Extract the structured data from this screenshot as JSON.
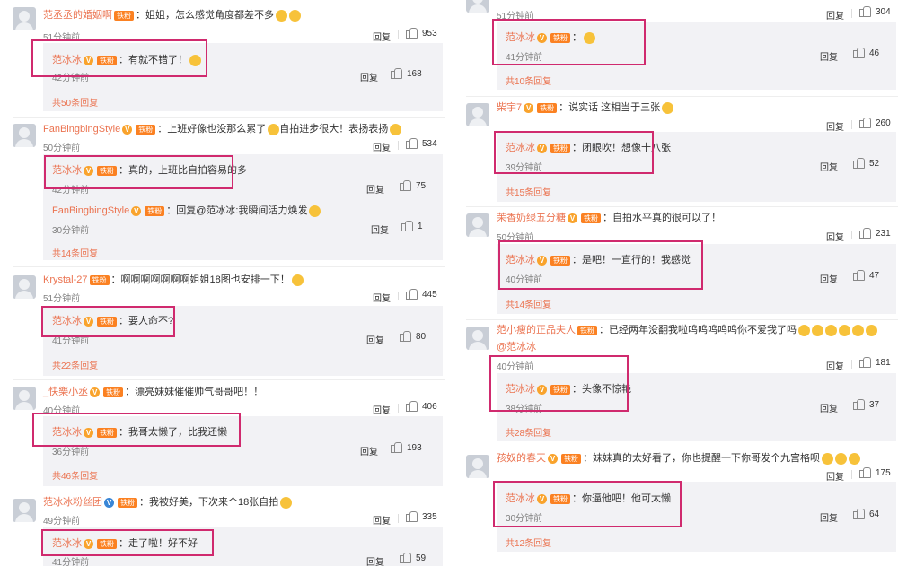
{
  "reply_label": "回复",
  "v_mark": "V",
  "fan_label": "铁粉",
  "left": [
    {
      "user": "范丞丞的婚姻啊",
      "text": "姐姐，怎么感觉角度都差不多",
      "time": "51分钟前",
      "likes": "953",
      "sub": [
        {
          "user": "范冰冰",
          "text": "有就不错了！",
          "time": "42分钟前",
          "likes": "168"
        }
      ],
      "more": "共50条回复"
    },
    {
      "user": "FanBingbingStyle",
      "text": "上班好像也没那么累了",
      "text2": "自拍进步很大！表扬表扬",
      "time": "50分钟前",
      "likes": "534",
      "sub": [
        {
          "user": "范冰冰",
          "text": "真的，上班比自拍容易的多",
          "time": "42分钟前",
          "likes": "75"
        },
        {
          "user": "FanBingbingStyle",
          "text": "回复@范冰冰:我瞬间活力焕发",
          "time": "30分钟前",
          "likes": "1"
        }
      ],
      "more": "共14条回复"
    },
    {
      "user": "Krystal-27",
      "text": "啊啊啊啊啊啊啊姐姐18图也安排一下！",
      "time": "51分钟前",
      "likes": "445",
      "sub": [
        {
          "user": "范冰冰",
          "text": "要人命不?",
          "time": "41分钟前",
          "likes": "80"
        }
      ],
      "more": "共22条回复"
    },
    {
      "user": "_快樂小丞",
      "text": "漂亮妹妹催催帅气哥哥吧！！",
      "time": "40分钟前",
      "likes": "406",
      "sub": [
        {
          "user": "范冰冰",
          "text": "我哥太懒了，比我还懒",
          "time": "36分钟前",
          "likes": "193"
        }
      ],
      "more": "共46条回复"
    },
    {
      "user": "范冰冰粉丝团",
      "text": "我被好美，下次来个18张自拍",
      "time": "49分钟前",
      "likes": "335",
      "sub": [
        {
          "user": "范冰冰",
          "text": "走了啦！好不好",
          "time": "41分钟前",
          "likes": "59"
        }
      ],
      "more": ""
    }
  ],
  "right": [
    {
      "user": "",
      "text": "",
      "time": "51分钟前",
      "likes": "304",
      "sub": [
        {
          "user": "范冰冰",
          "text": "",
          "time": "41分钟前",
          "likes": "46"
        }
      ],
      "more": "共10条回复"
    },
    {
      "user": "柴宇7",
      "text": "说实话 这相当于三张",
      "time": "",
      "likes": "260",
      "sub": [
        {
          "user": "范冰冰",
          "text": "闭眼吹！想像十八张",
          "time": "39分钟前",
          "likes": "52"
        }
      ],
      "more": "共15条回复"
    },
    {
      "user": "茉香奶绿五分糖",
      "text": "自拍水平真的很可以了！",
      "time": "50分钟前",
      "likes": "231",
      "sub": [
        {
          "user": "范冰冰",
          "text": "是吧！一直行的！我感觉",
          "time": "40分钟前",
          "likes": "47"
        }
      ],
      "more": "共14条回复"
    },
    {
      "user": "范小瘦的正品夫人",
      "text": "已经两年没翻我啦呜呜呜呜呜你不爱我了吗",
      "text2": "@范冰冰",
      "time": "40分钟前",
      "likes": "181",
      "sub": [
        {
          "user": "范冰冰",
          "text": "头像不惊艳",
          "time": "38分钟前",
          "likes": "37"
        }
      ],
      "more": "共28条回复"
    },
    {
      "user": "孩奴的春天",
      "text": "妹妹真的太好看了，你也提醒一下你哥发个九宫格呗",
      "time": "",
      "likes": "175",
      "sub": [
        {
          "user": "范冰冰",
          "text": "你逼他吧！他可太懒",
          "time": "30分钟前",
          "likes": "64"
        }
      ],
      "more": "共12条回复"
    }
  ]
}
